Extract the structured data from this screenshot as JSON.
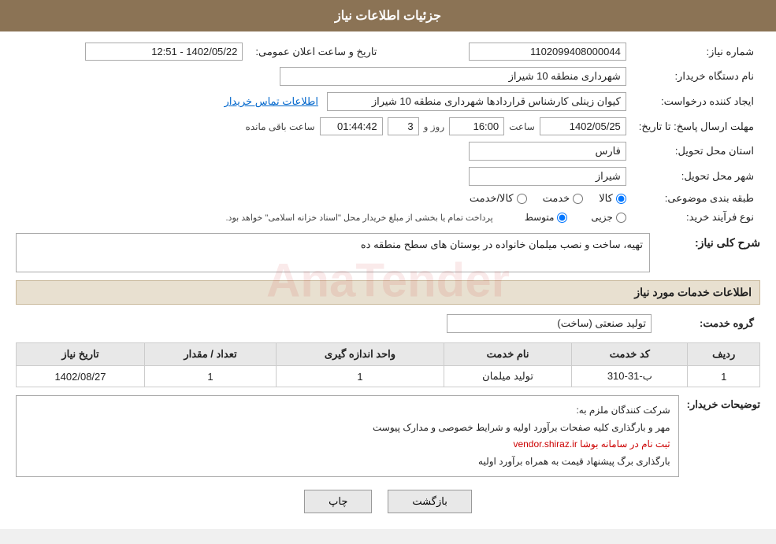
{
  "page": {
    "title": "جزئیات اطلاعات نیاز"
  },
  "fields": {
    "shomareNiaz_label": "شماره نیاز:",
    "shomareNiaz_value": "1102099408000044",
    "namDastgah_label": "نام دستگاه خریدار:",
    "namDastgah_value": "شهرداری منطقه 10 شیراز",
    "ijadKonande_label": "ایجاد کننده درخواست:",
    "ijadKonande_value": "کیوان زینلی کارشناس قراردادها شهرداری منطقه 10 شیراز",
    "ijadKonande_link": "اطلاعات تماس خریدار",
    "mohlat_label": "مهلت ارسال پاسخ: تا تاریخ:",
    "mohlat_date": "1402/05/25",
    "mohlat_time_label": "ساعت",
    "mohlat_time": "16:00",
    "mohlat_rooz_label": "روز و",
    "mohlat_rooz": "3",
    "mohlat_countdown_label": "ساعت باقی مانده",
    "mohlat_countdown": "01:44:42",
    "ostan_label": "استان محل تحویل:",
    "ostan_value": "فارس",
    "shahr_label": "شهر محل تحویل:",
    "shahr_value": "شیراز",
    "tabaqe_label": "طبقه بندی موضوعی:",
    "tabaqe_options": [
      "کالا/خدمت",
      "خدمت",
      "کالا"
    ],
    "tabaqe_selected": "کالا",
    "nowFarayand_label": "نوع فرآیند خرید:",
    "nowFarayand_options": [
      "جزیی",
      "متوسط"
    ],
    "nowFarayand_selected": "متوسط",
    "nowFarayand_note": "پرداخت تمام یا بخشی از مبلغ خریدار محل \"اسناد خزانه اسلامی\" خواهد بود.",
    "taarikh_label": "تاریخ و ساعت اعلان عمومی:",
    "taarikh_value": "1402/05/22 - 12:51",
    "sharhKoli_title": "شرح کلی نیاز:",
    "sharhKoli_value": "تهیه، ساخت و نصب میلمان خانواده در بوستان های سطح منطقه ده",
    "khadamat_title": "اطلاعات خدمات مورد نیاز",
    "grohKhadamat_label": "گروه خدمت:",
    "grohKhadamat_value": "تولید صنعتی (ساخت)",
    "table": {
      "headers": [
        "ردیف",
        "کد خدمت",
        "نام خدمت",
        "واحد اندازه گیری",
        "تعداد / مقدار",
        "تاریخ نیاز"
      ],
      "rows": [
        {
          "radif": "1",
          "kodKhadamat": "ب-31-310",
          "namKhadamat": "تولید میلمان",
          "vahed": "1",
          "tedad": "1",
          "taarikh": "1402/08/27"
        }
      ]
    },
    "tawzih_label": "توضیحات خریدار:",
    "tawzih_line1": "شرکت کنندگان ملزم به:",
    "tawzih_line2": "مهر و بارگذاری کلیه صفحات برآورد اولیه و شرایط خصوصی و مدارک پیوست",
    "tawzih_line3_red": "ثبت نام در سامانه بوشا vendor.shiraz.ir",
    "tawzih_line4": "بارگذاری برگ پیشنهاد قیمت به همراه برآورد اولیه",
    "btn_print": "چاپ",
    "btn_back": "بازگشت"
  }
}
